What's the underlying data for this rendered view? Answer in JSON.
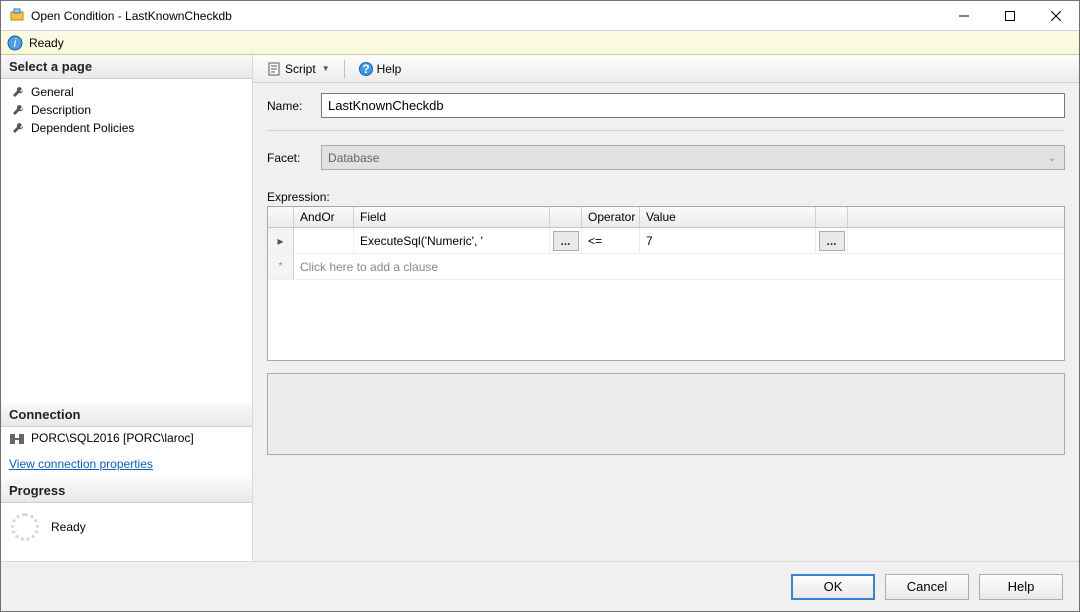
{
  "window": {
    "title": "Open Condition - LastKnownCheckdb"
  },
  "status": {
    "text": "Ready"
  },
  "sidebar": {
    "selectPageHeader": "Select a page",
    "items": [
      {
        "label": "General"
      },
      {
        "label": "Description"
      },
      {
        "label": "Dependent Policies"
      }
    ],
    "connectionHeader": "Connection",
    "connectionText": "PORC\\SQL2016 [PORC\\laroc]",
    "connectionLink": "View connection properties",
    "progressHeader": "Progress",
    "progressText": "Ready"
  },
  "toolbar": {
    "script": "Script",
    "help": "Help"
  },
  "form": {
    "nameLabel": "Name:",
    "nameValue": "LastKnownCheckdb",
    "facetLabel": "Facet:",
    "facetValue": "Database",
    "expressionLabel": "Expression:"
  },
  "grid": {
    "headers": {
      "andor": "AndOr",
      "field": "Field",
      "operator": "Operator",
      "value": "Value"
    },
    "row1": {
      "field": "ExecuteSql('Numeric', '",
      "operator": "<=",
      "value": "7",
      "ellipsis": "..."
    },
    "addClause": "Click here to add a clause"
  },
  "buttons": {
    "ok": "OK",
    "cancel": "Cancel",
    "help": "Help"
  }
}
